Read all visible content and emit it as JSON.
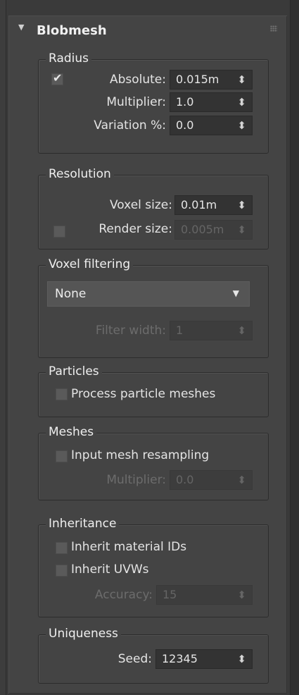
{
  "rollout": {
    "title": "Blobmesh"
  },
  "radius": {
    "title": "Radius",
    "absolute_label": "Absolute:",
    "absolute_value": "0.015m",
    "absolute_checked": true,
    "multiplier_label": "Multiplier:",
    "multiplier_value": "1.0",
    "variation_label": "Variation %:",
    "variation_value": "0.0"
  },
  "resolution": {
    "title": "Resolution",
    "voxel_label": "Voxel size:",
    "voxel_value": "0.01m",
    "render_label": "Render size:",
    "render_value": "0.005m"
  },
  "voxel_filtering": {
    "title": "Voxel filtering",
    "selected": "None",
    "filter_width_label": "Filter width:",
    "filter_width_value": "1"
  },
  "particles": {
    "title": "Particles",
    "process_label": "Process particle meshes"
  },
  "meshes": {
    "title": "Meshes",
    "resample_label": "Input mesh resampling",
    "multiplier_label": "Multiplier:",
    "multiplier_value": "0.0"
  },
  "inheritance": {
    "title": "Inheritance",
    "material_label": "Inherit material IDs",
    "uvw_label": "Inherit UVWs",
    "accuracy_label": "Accuracy:",
    "accuracy_value": "15"
  },
  "uniqueness": {
    "title": "Uniqueness",
    "seed_label": "Seed:",
    "seed_value": "12345"
  },
  "icons": {
    "spinner": "⬍",
    "collapse": "▼",
    "dropdown": "▼",
    "check": "✔"
  }
}
